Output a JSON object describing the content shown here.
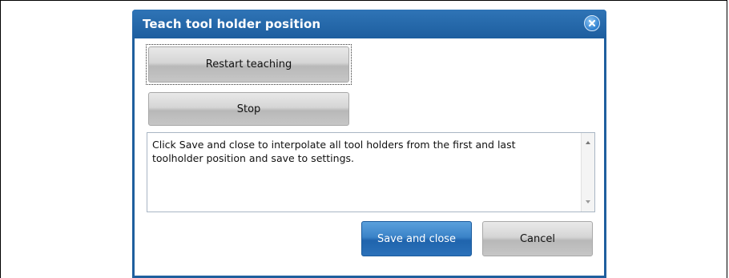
{
  "dialog": {
    "title": "Teach tool holder position",
    "buttons": {
      "restart_label": "Restart teaching",
      "stop_label": "Stop",
      "save_label": "Save and close",
      "cancel_label": "Cancel"
    },
    "message": "Click Save and close to interpolate all tool holders from the first and last toolholder position and save to settings."
  },
  "icons": {
    "close": "close-icon",
    "scroll_up": "scroll-up-arrow-icon",
    "scroll_down": "scroll-down-arrow-icon"
  },
  "colors": {
    "titlebar": "#1f5f9e",
    "primary_button": "#2b71b9",
    "secondary_button": "#c6c6c6"
  }
}
